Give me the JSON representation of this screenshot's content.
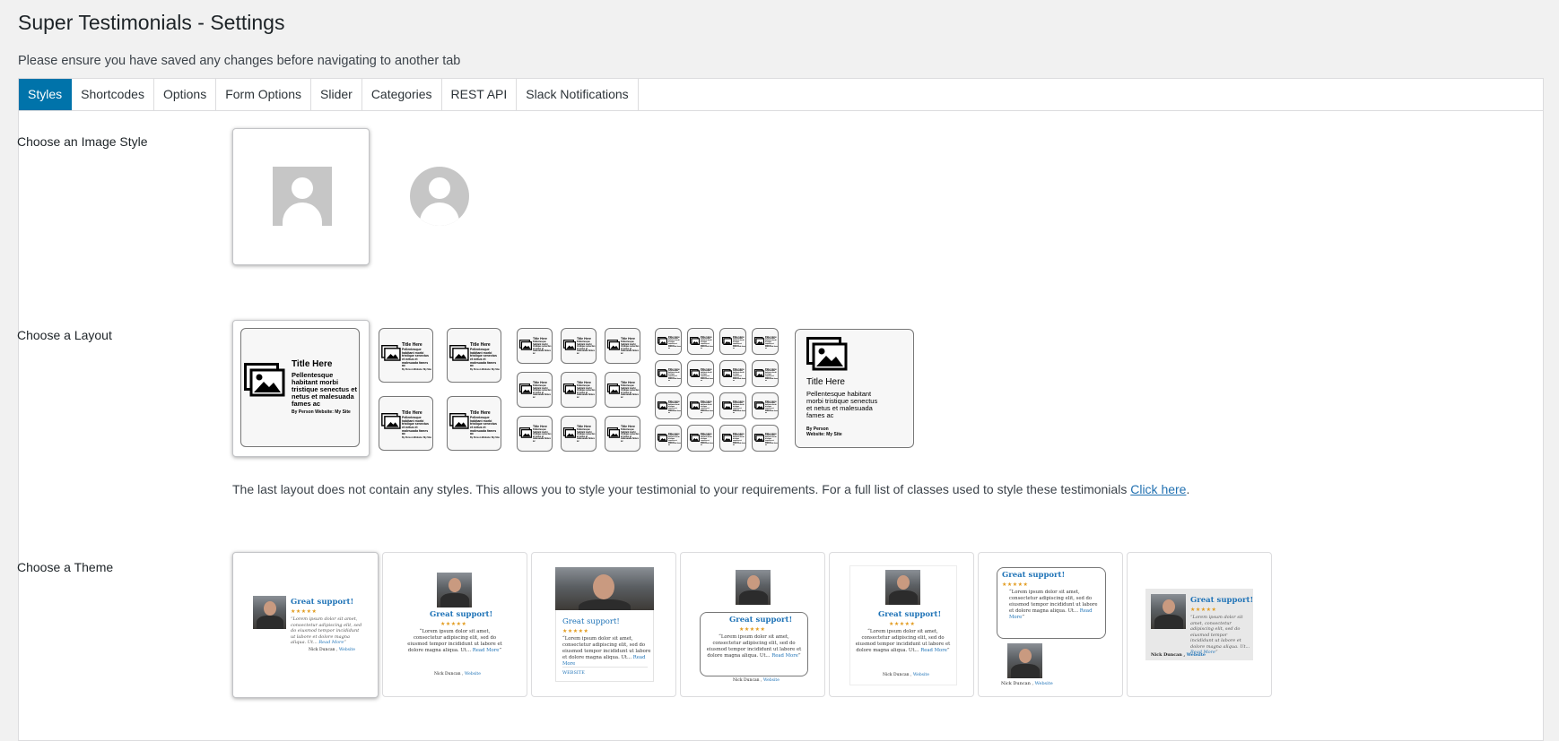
{
  "page": {
    "title": "Super Testimonials - Settings",
    "notice": "Please ensure you have saved any changes before navigating to another tab"
  },
  "tabs": [
    {
      "label": "Styles",
      "active": true
    },
    {
      "label": "Shortcodes"
    },
    {
      "label": "Options"
    },
    {
      "label": "Form Options"
    },
    {
      "label": "Slider"
    },
    {
      "label": "Categories"
    },
    {
      "label": "REST API"
    },
    {
      "label": "Slack Notifications"
    }
  ],
  "sections": {
    "image_style": {
      "label": "Choose an Image Style",
      "options": [
        "square",
        "circle"
      ],
      "selected": "square"
    },
    "layout": {
      "label": "Choose a Layout"
    },
    "theme": {
      "label": "Choose a Theme"
    }
  },
  "layout_sample": {
    "title": "Title Here",
    "body": "Pellentesque habitant morbi tristique senectus et netus et malesuada fames ac",
    "byline": "By Person Website: My Site",
    "person": "By Person",
    "website": "Website: My Site"
  },
  "help": {
    "text": "The last layout does not contain any styles. This allows you to style your testimonial to your requirements. For a full list of classes used to style these testimonials ",
    "link": "Click here",
    "after": "."
  },
  "theme_sample": {
    "title": "Great support!",
    "stars": "★★★★★",
    "quote": "“Lorem ipsum dolor sit amet, consectetur adipiscing elit, sed do eiusmod tempor incididunt ut labore et dolore magna aliqua. Ut...",
    "read_more": "Read More",
    "close_quote": "”",
    "name": "Nick Duncan",
    "separator": " , ",
    "website": "Website",
    "website_caps": "WEBSITE"
  },
  "colors": {
    "accent": "#0073aa",
    "link": "#2271b1",
    "star": "#e29b1e"
  }
}
